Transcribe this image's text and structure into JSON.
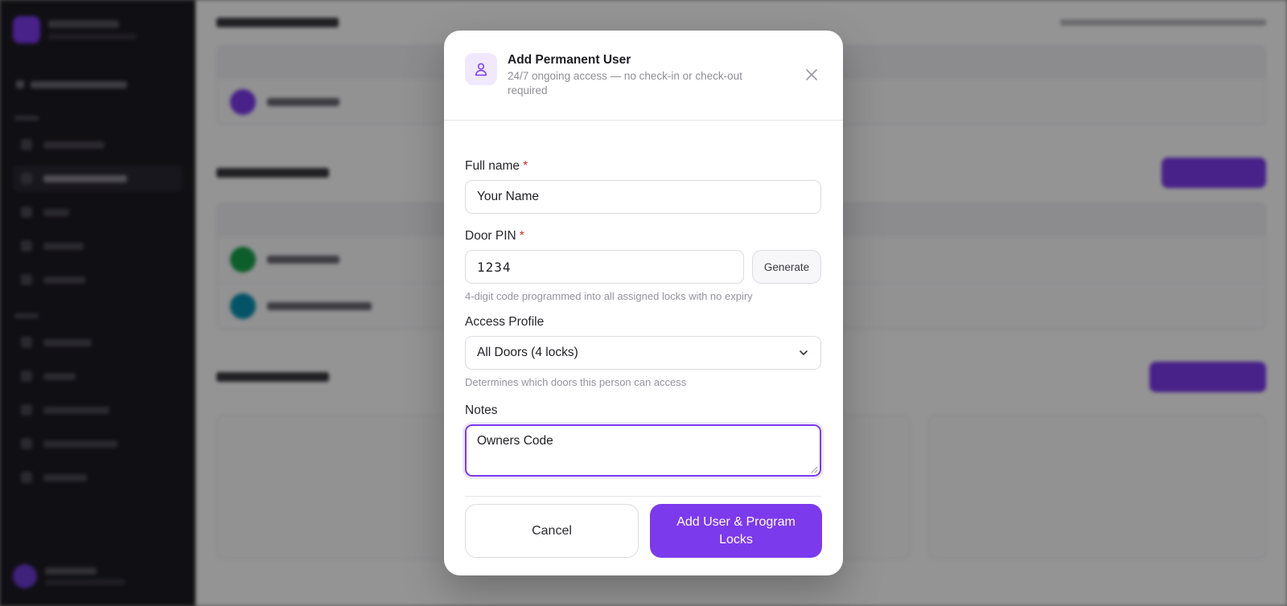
{
  "modal": {
    "title": "Add Permanent User",
    "subtitle": "24/7 ongoing access — no check-in or check-out required",
    "icon": "user-icon",
    "fields": {
      "full_name": {
        "label": "Full name",
        "required_mark": "*",
        "value": "Your Name"
      },
      "door_pin": {
        "label": "Door PIN",
        "required_mark": "*",
        "value": "1234",
        "generate_label": "Generate",
        "hint": "4-digit code programmed into all assigned locks with no expiry"
      },
      "access_profile": {
        "label": "Access Profile",
        "selected": "All Doors (4 locks)",
        "hint": "Determines which doors this person can access"
      },
      "notes": {
        "label": "Notes",
        "value": "Owners Code"
      }
    },
    "actions": {
      "cancel": "Cancel",
      "submit": "Add User & Program Locks"
    }
  },
  "colors": {
    "accent": "#7c3aed",
    "required": "#dc2626",
    "icon_bg": "#f0e9fe"
  }
}
